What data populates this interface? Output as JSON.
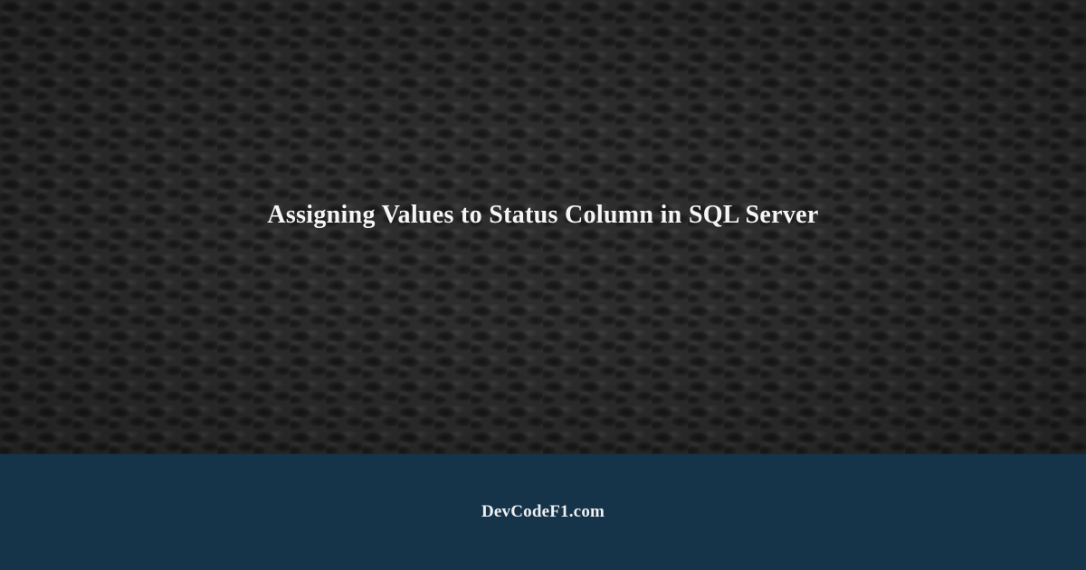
{
  "main": {
    "title": "Assigning Values to Status Column in SQL Server"
  },
  "footer": {
    "site_name": "DevCodeF1.com"
  }
}
